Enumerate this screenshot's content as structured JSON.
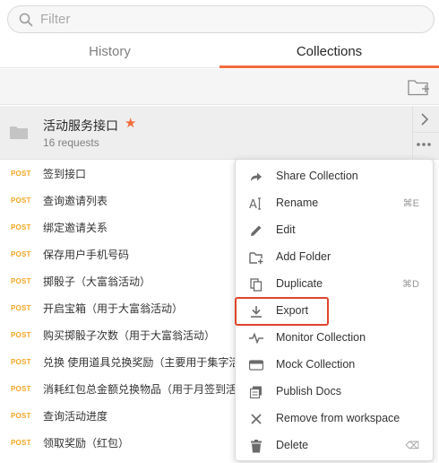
{
  "filter": {
    "placeholder": "Filter",
    "value": ""
  },
  "tabs": [
    {
      "label": "History",
      "active": false
    },
    {
      "label": "Collections",
      "active": true
    }
  ],
  "collection": {
    "name": "活动服务接口",
    "requests_count": "16 requests",
    "favorite": true
  },
  "requests": [
    {
      "method": "POST",
      "name": "签到接口"
    },
    {
      "method": "POST",
      "name": "查询邀请列表"
    },
    {
      "method": "POST",
      "name": "绑定邀请关系"
    },
    {
      "method": "POST",
      "name": "保存用户手机号码"
    },
    {
      "method": "POST",
      "name": "掷骰子（大富翁活动）"
    },
    {
      "method": "POST",
      "name": "开启宝箱（用于大富翁活动）"
    },
    {
      "method": "POST",
      "name": "购买掷骰子次数（用于大富翁活动）"
    },
    {
      "method": "POST",
      "name": "兑换 使用道具兑换奖励（主要用于集字活"
    },
    {
      "method": "POST",
      "name": "消耗红包总金额兑换物品（用于月签到活"
    },
    {
      "method": "POST",
      "name": "查询活动进度"
    },
    {
      "method": "POST",
      "name": "领取奖励（红包）"
    }
  ],
  "context_menu": {
    "items": [
      {
        "label": "Share Collection",
        "icon": "share-icon",
        "shortcut": ""
      },
      {
        "label": "Rename",
        "icon": "rename-icon",
        "shortcut": "⌘E"
      },
      {
        "label": "Edit",
        "icon": "pencil-icon",
        "shortcut": ""
      },
      {
        "label": "Add Folder",
        "icon": "add-folder-icon",
        "shortcut": ""
      },
      {
        "label": "Duplicate",
        "icon": "duplicate-icon",
        "shortcut": "⌘D"
      },
      {
        "label": "Export",
        "icon": "download-icon",
        "shortcut": "",
        "highlighted": true
      },
      {
        "label": "Monitor Collection",
        "icon": "pulse-icon",
        "shortcut": ""
      },
      {
        "label": "Mock Collection",
        "icon": "server-icon",
        "shortcut": ""
      },
      {
        "label": "Publish Docs",
        "icon": "docs-icon",
        "shortcut": ""
      },
      {
        "label": "Remove from workspace",
        "icon": "close-icon",
        "shortcut": ""
      },
      {
        "label": "Delete",
        "icon": "trash-icon",
        "shortcut": "⌫"
      }
    ]
  },
  "colors": {
    "accent": "#f26b3a",
    "post_method": "#f5a623",
    "highlight_box": "#e0442c"
  }
}
